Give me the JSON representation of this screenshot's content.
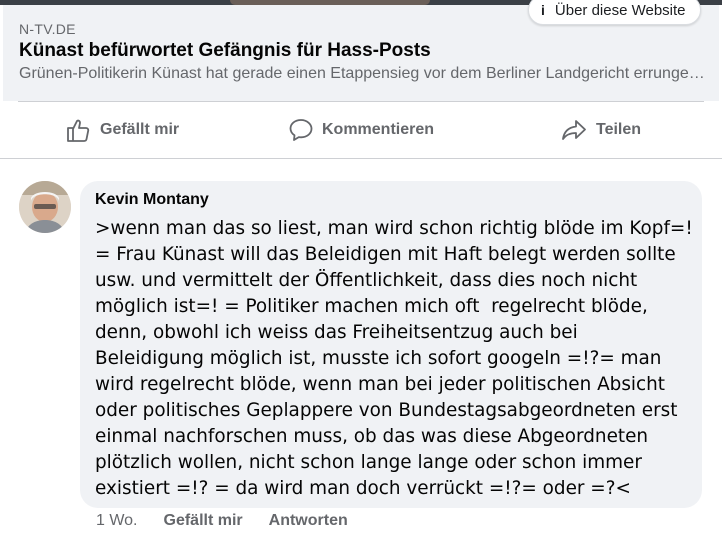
{
  "link_preview": {
    "about_label": "Über diese Website",
    "source": "N-TV.DE",
    "headline": "Künast befürwortet Gefängnis für Hass-Posts",
    "description": "Grünen-Politikerin Künast hat gerade einen Etappensieg vor dem Berliner Landgericht errungen..."
  },
  "actions": {
    "like_label": "Gefällt mir",
    "comment_label": "Kommentieren",
    "share_label": "Teilen"
  },
  "comment": {
    "author": "Kevin Montany",
    "text": ">wenn man das so liest, man wird schon richtig blöde im Kopf=!\n= Frau Künast will das Beleidigen mit Haft belegt werden sollte\nusw. und vermittelt der Öffentlichkeit, dass dies noch nicht\nmöglich ist=! = Politiker machen mich oft  regelrecht blöde,\ndenn, obwohl ich weiss das Freiheitsentzug auch bei\nBeleidigung möglich ist, musste ich sofort googeln =!?= man\nwird regelrecht blöde, wenn man bei jeder politischen Absicht\noder politisches Geplappere von Bundestagsabgeordneten erst\neinmal nachforschen muss, ob das was diese Abgeordneten\nplötzlich wollen, nicht schon lange lange oder schon immer\nexistiert =!? = da wird man doch verrückt =!?= oder =?<",
    "time": "1 Wo.",
    "like_label": "Gefällt mir",
    "reply_label": "Antworten"
  },
  "colors": {
    "secondary_text": "#65676b",
    "bubble_bg": "#f0f2f5",
    "divider": "#ced0d4"
  }
}
